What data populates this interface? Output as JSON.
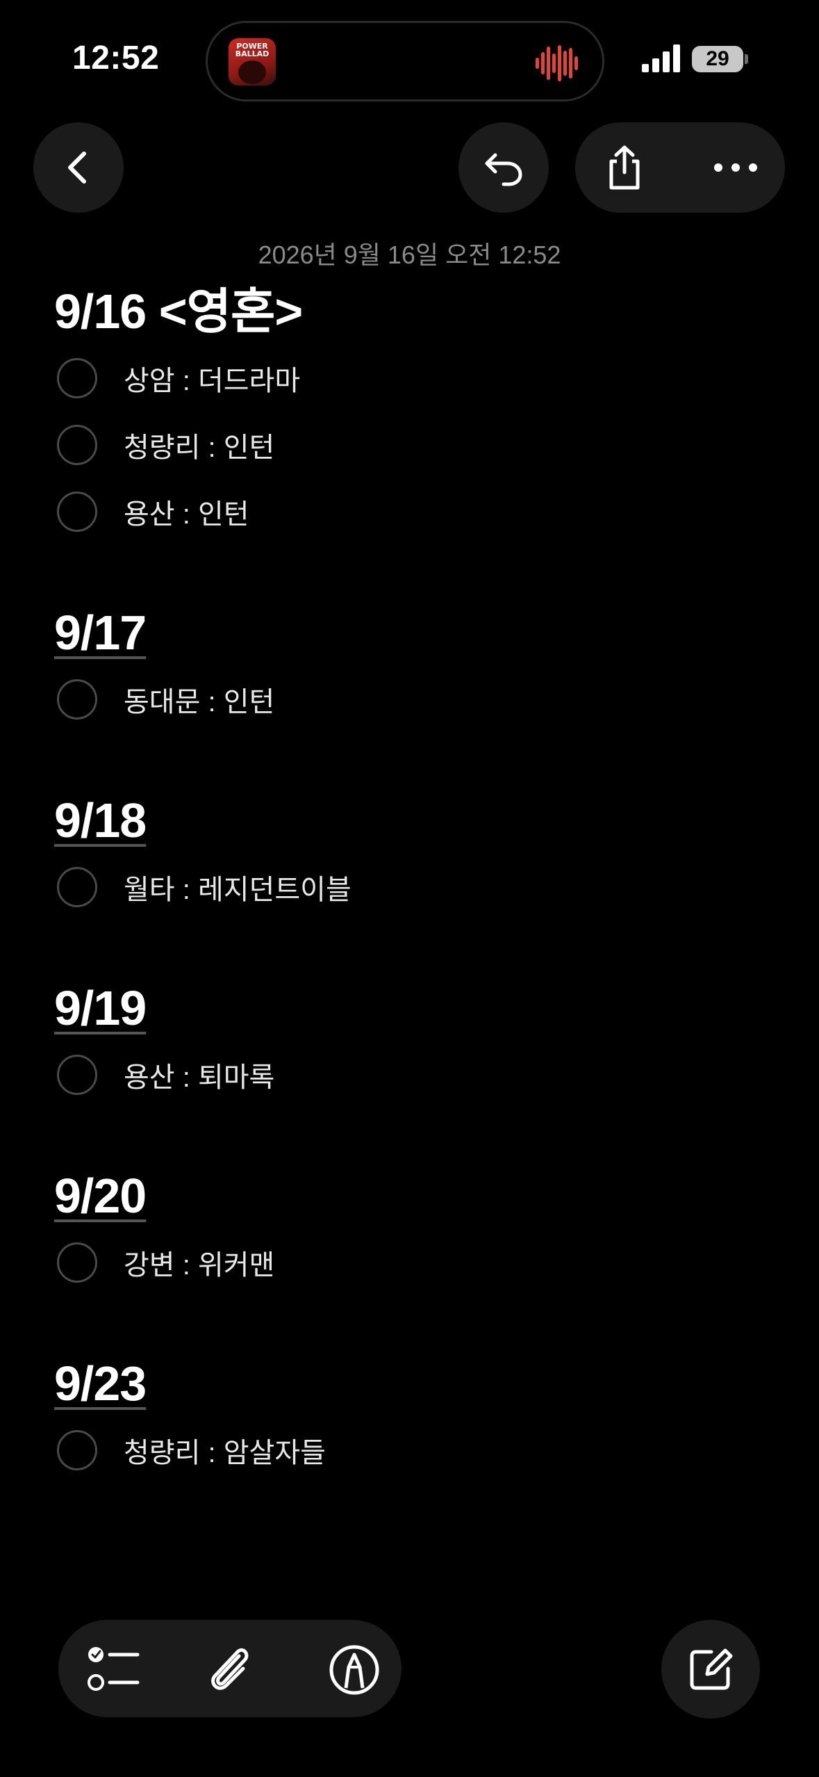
{
  "status_bar": {
    "time": "12:52",
    "battery": "29",
    "album_text": "POWER BALLAD"
  },
  "top_bar": {
    "back_icon": "chevron-left-icon",
    "undo_icon": "undo-icon",
    "share_icon": "share-icon",
    "more_icon": "ellipsis-icon"
  },
  "note": {
    "date": "2026년 9월 16일 오전 12:52",
    "sections": [
      {
        "title": "9/16 <영혼>",
        "items": [
          "상암 : 더드라마",
          "청량리 : 인턴",
          "용산 : 인턴"
        ]
      },
      {
        "title": "9/17",
        "items": [
          "동대문 : 인턴"
        ]
      },
      {
        "title": "9/18",
        "items": [
          "월타 : 레지던트이블"
        ]
      },
      {
        "title": "9/19",
        "items": [
          "용산 : 퇴마록"
        ]
      },
      {
        "title": "9/20",
        "items": [
          "강변 : 위커맨"
        ]
      },
      {
        "title": "9/23",
        "items": [
          "청량리 : 암살자들"
        ]
      }
    ]
  },
  "toolbar": {
    "checklist_icon": "checklist-icon",
    "attach_icon": "paperclip-icon",
    "markup_icon": "markup-pen-icon",
    "compose_icon": "compose-icon"
  },
  "colors": {
    "background": "#000000",
    "button_bg": "#1b1b1b",
    "date_text": "#8a8a8a",
    "wave_accent": "#e0453a"
  }
}
